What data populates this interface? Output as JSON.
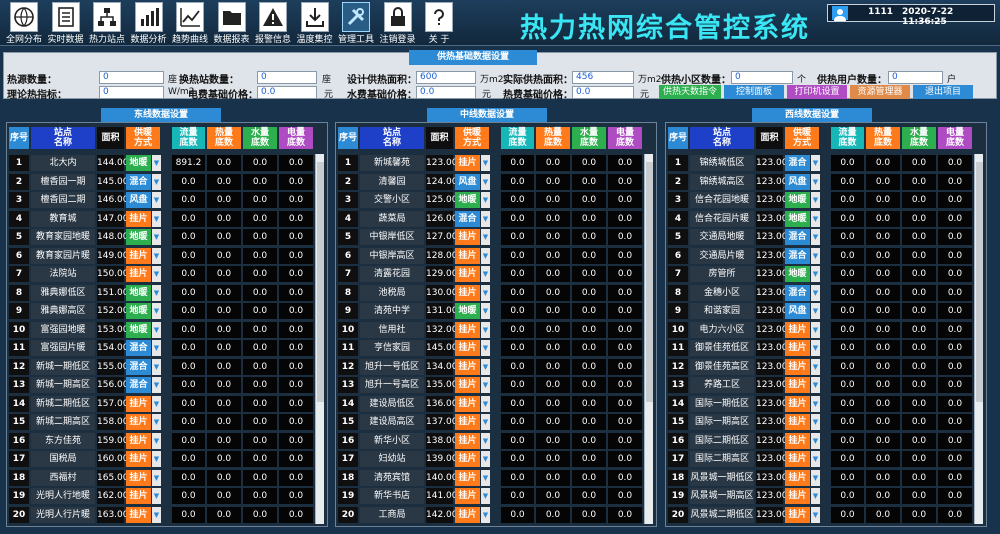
{
  "toolbar": [
    {
      "label": "全网分布",
      "icon": "map-icon"
    },
    {
      "label": "实时数据",
      "icon": "document-icon"
    },
    {
      "label": "热力站点",
      "icon": "network-icon"
    },
    {
      "label": "数据分析",
      "icon": "bar-chart-icon"
    },
    {
      "label": "趋势曲线",
      "icon": "trend-chart-icon"
    },
    {
      "label": "数据报表",
      "icon": "folder-icon"
    },
    {
      "label": "报警信息",
      "icon": "warning-icon"
    },
    {
      "label": "温度集控",
      "icon": "download-icon"
    },
    {
      "label": "管理工具",
      "icon": "tools-icon"
    },
    {
      "label": "注销登录",
      "icon": "lock-icon"
    },
    {
      "label": "关  于",
      "icon": "help-icon"
    }
  ],
  "title": "热力热网综合管控系统",
  "user": {
    "id": "1111",
    "datetime": "2020-7-22 11:36:25"
  },
  "basic": {
    "header": "供热基础数据设置",
    "source_label": "热源数量：",
    "source_value": "0",
    "source_unit": "座",
    "station_label": "换热站数量：",
    "station_value": "0",
    "station_unit": "座",
    "design_label": "设计供热面积：",
    "design_value": "600",
    "design_unit": "万m2",
    "actual_label": "实际供热面积：",
    "actual_value": "456",
    "actual_unit": "万m2",
    "community_label": "供热小区数量：",
    "community_value": "0",
    "community_unit": "个",
    "users_label": "供热用户数量：",
    "users_value": "0",
    "users_unit": "户",
    "index_label": "理论热指标：",
    "index_value": "0",
    "index_unit": "W/m2",
    "elec_label": "电费基础价格：",
    "elec_value": "0.0",
    "elec_unit": "元",
    "water_label": "水费基础价格：",
    "water_value": "0.0",
    "water_unit": "元",
    "heat_label": "热费基础价格：",
    "heat_value": "0.0",
    "heat_unit": "元",
    "btn_weather": "供热天数指令",
    "btn_control": "控制面板",
    "btn_print": "打印机设置",
    "btn_resource": "资源管理器",
    "btn_exit": "退出项目"
  },
  "columns": [
    "序号",
    "站点\n名称",
    "面积",
    "供暖\n方式",
    "流量\n底数",
    "热量\n底数",
    "水量\n底数",
    "电量\n底数"
  ],
  "panels": [
    {
      "title": "东线数据设置",
      "rows": [
        [
          "1",
          "北大内",
          "144.00",
          "地暖",
          "891.2",
          "0.0",
          "0.0",
          "0.0"
        ],
        [
          "2",
          "檀香园一期",
          "145.00",
          "混合",
          "0.0",
          "0.0",
          "0.0",
          "0.0"
        ],
        [
          "3",
          "檀香园二期",
          "146.00",
          "风盘",
          "0.0",
          "0.0",
          "0.0",
          "0.0"
        ],
        [
          "4",
          "教育城",
          "147.00",
          "挂片",
          "0.0",
          "0.0",
          "0.0",
          "0.0"
        ],
        [
          "5",
          "教育家园地暖",
          "148.00",
          "地暖",
          "0.0",
          "0.0",
          "0.0",
          "0.0"
        ],
        [
          "6",
          "教育家园片暖",
          "149.00",
          "挂片",
          "0.0",
          "0.0",
          "0.0",
          "0.0"
        ],
        [
          "7",
          "法院站",
          "150.00",
          "挂片",
          "0.0",
          "0.0",
          "0.0",
          "0.0"
        ],
        [
          "8",
          "雅典娜低区",
          "151.00",
          "地暖",
          "0.0",
          "0.0",
          "0.0",
          "0.0"
        ],
        [
          "9",
          "雅典娜高区",
          "152.00",
          "地暖",
          "0.0",
          "0.0",
          "0.0",
          "0.0"
        ],
        [
          "10",
          "富强园地暖",
          "153.00",
          "地暖",
          "0.0",
          "0.0",
          "0.0",
          "0.0"
        ],
        [
          "11",
          "富强园片暖",
          "154.00",
          "混合",
          "0.0",
          "0.0",
          "0.0",
          "0.0"
        ],
        [
          "12",
          "新城一期低区",
          "155.00",
          "混合",
          "0.0",
          "0.0",
          "0.0",
          "0.0"
        ],
        [
          "13",
          "新城一期高区",
          "156.00",
          "混合",
          "0.0",
          "0.0",
          "0.0",
          "0.0"
        ],
        [
          "14",
          "新城二期低区",
          "157.00",
          "挂片",
          "0.0",
          "0.0",
          "0.0",
          "0.0"
        ],
        [
          "15",
          "新城二期高区",
          "158.00",
          "挂片",
          "0.0",
          "0.0",
          "0.0",
          "0.0"
        ],
        [
          "16",
          "东方佳苑",
          "159.00",
          "挂片",
          "0.0",
          "0.0",
          "0.0",
          "0.0"
        ],
        [
          "17",
          "国税局",
          "160.00",
          "挂片",
          "0.0",
          "0.0",
          "0.0",
          "0.0"
        ],
        [
          "18",
          "西福村",
          "165.00",
          "挂片",
          "0.0",
          "0.0",
          "0.0",
          "0.0"
        ],
        [
          "19",
          "光明人行地暖",
          "162.00",
          "挂片",
          "0.0",
          "0.0",
          "0.0",
          "0.0"
        ],
        [
          "20",
          "光明人行片暖",
          "163.00",
          "挂片",
          "0.0",
          "0.0",
          "0.0",
          "0.0"
        ]
      ]
    },
    {
      "title": "中线数据设置",
      "rows": [
        [
          "1",
          "新城馨苑",
          "123.00",
          "挂片",
          "0.0",
          "0.0",
          "0.0",
          "0.0"
        ],
        [
          "2",
          "清馨园",
          "124.00",
          "风盘",
          "0.0",
          "0.0",
          "0.0",
          "0.0"
        ],
        [
          "3",
          "交警小区",
          "125.00",
          "地暖",
          "0.0",
          "0.0",
          "0.0",
          "0.0"
        ],
        [
          "4",
          "蔬菜局",
          "126.00",
          "混合",
          "0.0",
          "0.0",
          "0.0",
          "0.0"
        ],
        [
          "5",
          "中银岸低区",
          "127.00",
          "挂片",
          "0.0",
          "0.0",
          "0.0",
          "0.0"
        ],
        [
          "6",
          "中银岸高区",
          "128.00",
          "挂片",
          "0.0",
          "0.0",
          "0.0",
          "0.0"
        ],
        [
          "7",
          "清露花园",
          "129.00",
          "挂片",
          "0.0",
          "0.0",
          "0.0",
          "0.0"
        ],
        [
          "8",
          "池税局",
          "130.00",
          "挂片",
          "0.0",
          "0.0",
          "0.0",
          "0.0"
        ],
        [
          "9",
          "清苑中学",
          "131.00",
          "地暖",
          "0.0",
          "0.0",
          "0.0",
          "0.0"
        ],
        [
          "10",
          "信用社",
          "132.00",
          "挂片",
          "0.0",
          "0.0",
          "0.0",
          "0.0"
        ],
        [
          "11",
          "亨信家园",
          "145.00",
          "挂片",
          "0.0",
          "0.0",
          "0.0",
          "0.0"
        ],
        [
          "12",
          "旭升一号低区",
          "134.00",
          "挂片",
          "0.0",
          "0.0",
          "0.0",
          "0.0"
        ],
        [
          "13",
          "旭升一号高区",
          "135.00",
          "挂片",
          "0.0",
          "0.0",
          "0.0",
          "0.0"
        ],
        [
          "14",
          "建设局低区",
          "136.00",
          "挂片",
          "0.0",
          "0.0",
          "0.0",
          "0.0"
        ],
        [
          "15",
          "建设局高区",
          "137.00",
          "挂片",
          "0.0",
          "0.0",
          "0.0",
          "0.0"
        ],
        [
          "16",
          "新华小区",
          "138.00",
          "挂片",
          "0.0",
          "0.0",
          "0.0",
          "0.0"
        ],
        [
          "17",
          "妇幼站",
          "139.00",
          "挂片",
          "0.0",
          "0.0",
          "0.0",
          "0.0"
        ],
        [
          "18",
          "清苑宾馆",
          "140.00",
          "挂片",
          "0.0",
          "0.0",
          "0.0",
          "0.0"
        ],
        [
          "19",
          "新华书店",
          "141.00",
          "挂片",
          "0.0",
          "0.0",
          "0.0",
          "0.0"
        ],
        [
          "20",
          "工商局",
          "142.00",
          "挂片",
          "0.0",
          "0.0",
          "0.0",
          "0.0"
        ]
      ]
    },
    {
      "title": "西线数据设置",
      "rows": [
        [
          "1",
          "锦绣城低区",
          "123.00",
          "混合",
          "0.0",
          "0.0",
          "0.0",
          "0.0"
        ],
        [
          "2",
          "锦绣城高区",
          "123.00",
          "风盘",
          "0.0",
          "0.0",
          "0.0",
          "0.0"
        ],
        [
          "3",
          "信合花园地暖",
          "123.00",
          "地暖",
          "0.0",
          "0.0",
          "0.0",
          "0.0"
        ],
        [
          "4",
          "信合花园片暖",
          "123.00",
          "地暖",
          "0.0",
          "0.0",
          "0.0",
          "0.0"
        ],
        [
          "5",
          "交通局地暖",
          "123.00",
          "混合",
          "0.0",
          "0.0",
          "0.0",
          "0.0"
        ],
        [
          "6",
          "交通局片暖",
          "123.00",
          "混合",
          "0.0",
          "0.0",
          "0.0",
          "0.0"
        ],
        [
          "7",
          "房管所",
          "123.00",
          "地暖",
          "0.0",
          "0.0",
          "0.0",
          "0.0"
        ],
        [
          "8",
          "金穗小区",
          "123.00",
          "混合",
          "0.0",
          "0.0",
          "0.0",
          "0.0"
        ],
        [
          "9",
          "和谐家园",
          "123.00",
          "风盘",
          "0.0",
          "0.0",
          "0.0",
          "0.0"
        ],
        [
          "10",
          "电力六小区",
          "123.00",
          "挂片",
          "0.0",
          "0.0",
          "0.0",
          "0.0"
        ],
        [
          "11",
          "御景佳苑低区",
          "123.00",
          "挂片",
          "0.0",
          "0.0",
          "0.0",
          "0.0"
        ],
        [
          "12",
          "御景佳苑高区",
          "123.00",
          "挂片",
          "0.0",
          "0.0",
          "0.0",
          "0.0"
        ],
        [
          "13",
          "养路工区",
          "123.00",
          "挂片",
          "0.0",
          "0.0",
          "0.0",
          "0.0"
        ],
        [
          "14",
          "国际一期低区",
          "123.00",
          "挂片",
          "0.0",
          "0.0",
          "0.0",
          "0.0"
        ],
        [
          "15",
          "国际一期高区",
          "123.00",
          "挂片",
          "0.0",
          "0.0",
          "0.0",
          "0.0"
        ],
        [
          "16",
          "国际二期低区",
          "123.00",
          "挂片",
          "0.0",
          "0.0",
          "0.0",
          "0.0"
        ],
        [
          "17",
          "国际二期高区",
          "123.00",
          "挂片",
          "0.0",
          "0.0",
          "0.0",
          "0.0"
        ],
        [
          "18",
          "风景城一期低区",
          "123.00",
          "挂片",
          "0.0",
          "0.0",
          "0.0",
          "0.0"
        ],
        [
          "19",
          "风景城一期高区",
          "123.00",
          "挂片",
          "0.0",
          "0.0",
          "0.0",
          "0.0"
        ],
        [
          "20",
          "风景城二期低区",
          "123.00",
          "挂片",
          "0.0",
          "0.0",
          "0.0",
          "0.0"
        ]
      ]
    }
  ],
  "mode_colors": {
    "地暖": "#2eaf4f",
    "混合": "#2d8bd6",
    "风盘": "#2d8bd6",
    "挂片": "#ff7a1a"
  },
  "header_colors": {
    "序号": "#2d8bd6",
    "站点\n名称": "#1e40c8",
    "面积": "#0e0e0e",
    "供暖\n方式": "#ff7a1a",
    "流量\n底数": "#18b7b7",
    "热量\n底数": "#ff7a1a",
    "水量\n底数": "#2eaf4f",
    "电量\n底数": "#b04cc3"
  }
}
